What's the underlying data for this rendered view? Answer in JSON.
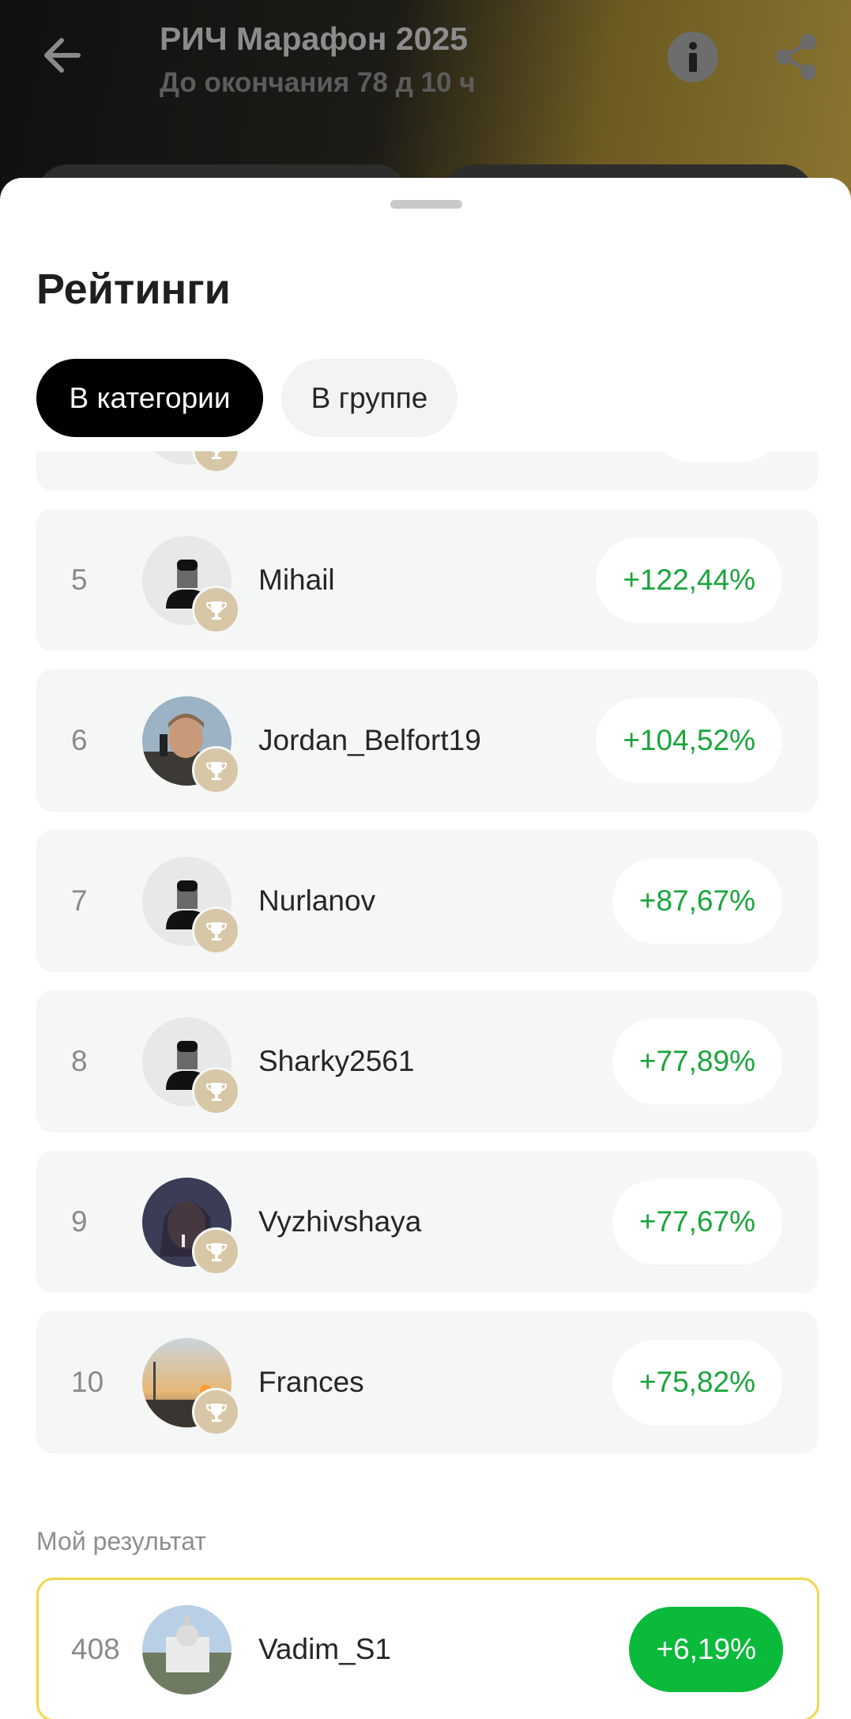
{
  "header": {
    "title": "РИЧ Марафон 2025",
    "subtitle": "До окончания 78 д 10 ч",
    "back_icon": "arrow-left-icon",
    "info_icon": "info-icon",
    "share_icon": "share-icon"
  },
  "sheet": {
    "title": "Рейтинги",
    "tabs": [
      {
        "label": "В категории",
        "active": true
      },
      {
        "label": "В группе",
        "active": false
      }
    ]
  },
  "rankings": [
    {
      "rank": "",
      "name": "",
      "result": "",
      "avatar": "default-user-icon"
    },
    {
      "rank": "5",
      "name": "Mihail",
      "result": "+122,44%",
      "avatar": "default-user-icon"
    },
    {
      "rank": "6",
      "name": "Jordan_Belfort19",
      "result": "+104,52%",
      "avatar": "photo"
    },
    {
      "rank": "7",
      "name": "Nurlanov",
      "result": "+87,67%",
      "avatar": "default-user-icon"
    },
    {
      "rank": "8",
      "name": "Sharky2561",
      "result": "+77,89%",
      "avatar": "default-user-icon"
    },
    {
      "rank": "9",
      "name": "Vyzhivshaya",
      "result": "+77,67%",
      "avatar": "photo"
    },
    {
      "rank": "10",
      "name": "Frances",
      "result": "+75,82%",
      "avatar": "photo"
    }
  ],
  "my_result": {
    "label": "Мой результат",
    "rank": "408",
    "name": "Vadim_S1",
    "result": "+6,19%",
    "avatar": "photo"
  },
  "colors": {
    "positive": "#1aa53c",
    "my_result_badge": "#0bba3b",
    "my_result_border": "#f2d64b",
    "trophy": "#d8c7a7"
  }
}
